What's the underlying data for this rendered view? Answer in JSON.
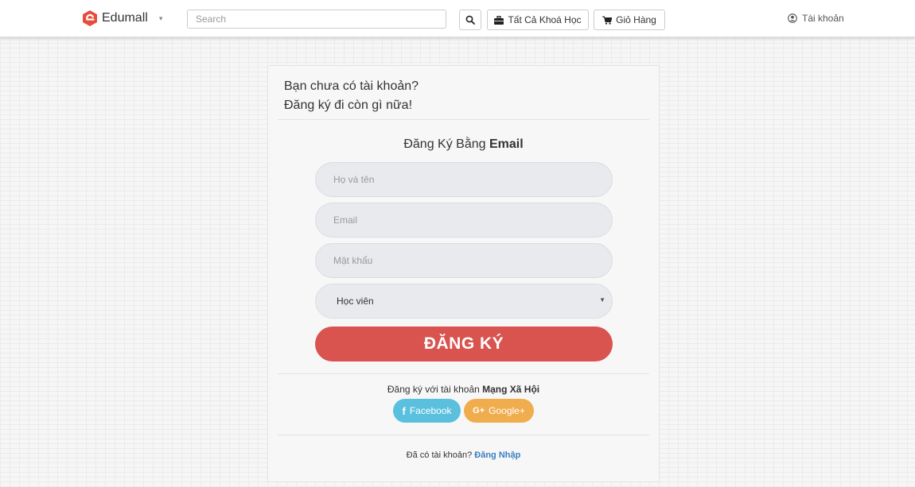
{
  "navbar": {
    "brand_name": "Edumall",
    "brand_color": "#e84c3d",
    "brand_caret": "▾",
    "search_placeholder": "Search",
    "search_icon": "search-icon",
    "all_courses_label": "Tất Cả Khoá Học",
    "all_courses_icon": "briefcase-icon",
    "cart_label": "Giỏ Hàng",
    "cart_icon": "cart-icon",
    "account_label": "Tài khoản",
    "account_icon": "user-circle-icon"
  },
  "signup": {
    "heading_line1": "Bạn chưa có tài khoản?",
    "heading_line2": "Đăng ký đi còn gì nữa!",
    "form_title_prefix": "Đăng Ký Bằng ",
    "form_title_bold": "Email",
    "name_placeholder": "Họ và tên",
    "email_placeholder": "Email",
    "password_placeholder": "Mật khẩu",
    "role_selected": "Học viên",
    "role_arrow": "▼",
    "submit_label": "ĐĂNG KÝ",
    "submit_color": "#d9534f",
    "social_prefix": "Đăng ký với tài khoản ",
    "social_bold": "Mạng Xã Hội",
    "facebook_icon": "f",
    "facebook_label": "Facebook",
    "facebook_color": "#5bc0de",
    "google_icon": "G+",
    "google_label": "Google+",
    "google_color": "#f0ad4e",
    "have_account_text": "Đã có tài khoản? ",
    "login_link": "Đăng Nhập"
  }
}
